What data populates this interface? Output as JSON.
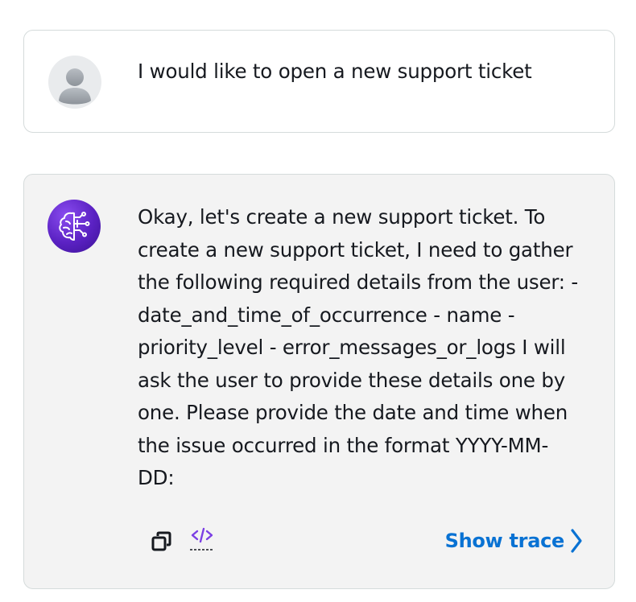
{
  "conversation": {
    "user_message": {
      "avatar_icon": "user-silhouette-icon",
      "text": "I would like to open a new support ticket"
    },
    "assistant_message": {
      "avatar_icon": "ai-brain-circuit-icon",
      "text": "Okay, let's create a new support ticket. To create a new support ticket, I need to gather the following required details from the user: - date_and_time_of_occurrence - name - priority_level - error_messages_or_logs I will ask the user to provide these details one by one. Please provide the date and time when the issue occurred in the format YYYY-MM-DD:",
      "actions": {
        "copy_icon": "copy-icon",
        "code_icon": "code-icon",
        "show_trace_label": "Show trace",
        "chevron_icon": "chevron-right-icon"
      }
    }
  },
  "colors": {
    "link_blue": "#0972d3",
    "code_icon_purple": "#7b3fe4",
    "assistant_bubble_bg": "#f3f3f3",
    "border": "#d5dbdb"
  }
}
